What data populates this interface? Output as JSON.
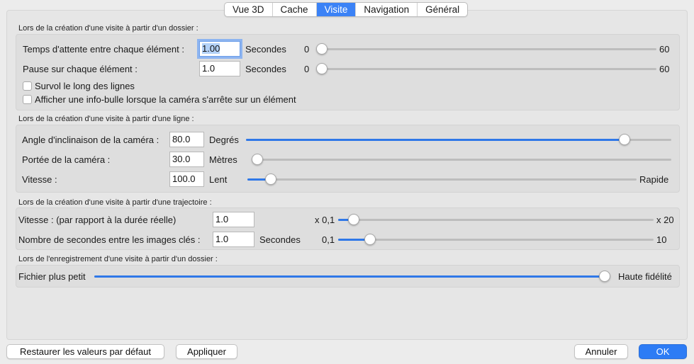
{
  "tabs": [
    "Vue 3D",
    "Cache",
    "Visite",
    "Navigation",
    "Général"
  ],
  "active_tab": "Visite",
  "accent_color": "#3b82f6",
  "section1": {
    "title": "Lors de la création d'une visite à partir d'un dossier :",
    "wait_label": "Temps d'attente entre chaque élément :",
    "wait_value": "1.00",
    "wait_unit": "Secondes",
    "wait_min": "0",
    "wait_max": "60",
    "wait_level": 0.0,
    "pause_label": "Pause sur chaque élément :",
    "pause_value": "1.0",
    "pause_unit": "Secondes",
    "pause_min": "0",
    "pause_max": "60",
    "pause_level": 0.0,
    "check1_label": "Survol le long des lignes",
    "check1_checked": false,
    "check2_label": "Afficher une info-bulle lorsque la caméra s'arrête sur un élément",
    "check2_checked": false
  },
  "section2": {
    "title": "Lors de la création d'une visite à partir d'une ligne :",
    "angle_label": "Angle d'inclinaison de la caméra :",
    "angle_value": "80.0",
    "angle_unit": "Degrés",
    "angle_level": 0.89,
    "range_label": "Portée de la caméra :",
    "range_value": "30.0",
    "range_unit": "Mètres",
    "range_level": 0.0,
    "speed_label": "Vitesse :",
    "speed_value": "100.0",
    "speed_unit": "Lent",
    "speed_max_label": "Rapide",
    "speed_level": 0.06
  },
  "section3": {
    "title": "Lors de la création d'une visite à partir d'une trajectoire :",
    "speed_label": "Vitesse : (par rapport à la durée réelle)",
    "speed_value": "1.0",
    "speed_min": "x 0,1",
    "speed_max": "x 20",
    "speed_level": 0.05,
    "keyframes_label": "Nombre de secondes entre les images clés :",
    "keyframes_value": "1.0",
    "keyframes_unit": "Secondes",
    "keyframes_min": "0,1",
    "keyframes_max": "10",
    "keyframes_level": 0.1
  },
  "section4": {
    "title": "Lors de l'enregistrement d'une visite à partir d'un dossier :",
    "min_label": "Fichier plus petit",
    "max_label": "Haute fidélité",
    "level": 1.0
  },
  "buttons": {
    "restore": "Restaurer les valeurs par défaut",
    "apply": "Appliquer",
    "cancel": "Annuler",
    "ok": "OK"
  }
}
